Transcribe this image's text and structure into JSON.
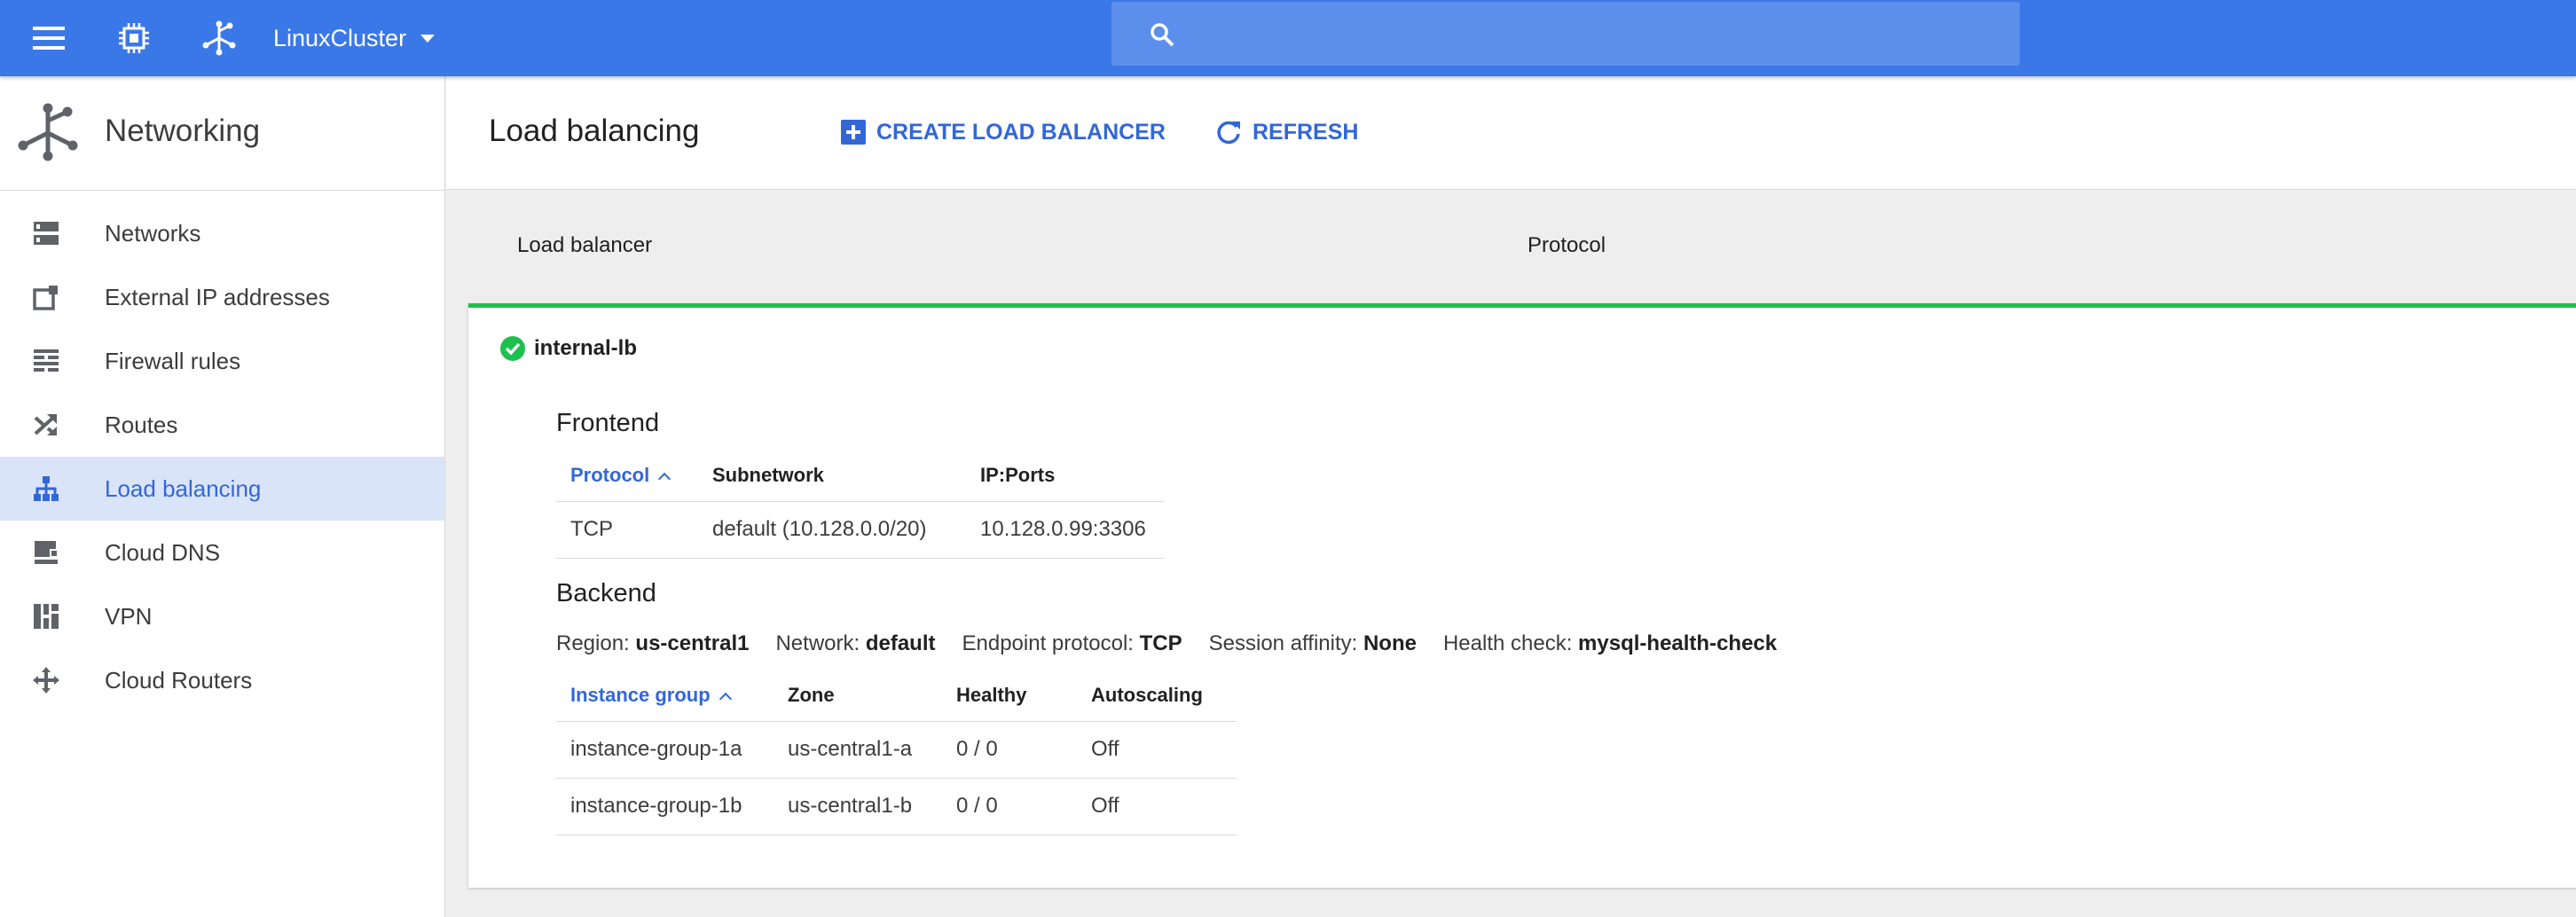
{
  "topbar": {
    "project": "LinuxCluster",
    "search_placeholder": ""
  },
  "sidebar": {
    "title": "Networking",
    "items": [
      {
        "label": "Networks",
        "icon": "networks-icon"
      },
      {
        "label": "External IP addresses",
        "icon": "external-ip-icon"
      },
      {
        "label": "Firewall rules",
        "icon": "firewall-icon"
      },
      {
        "label": "Routes",
        "icon": "routes-icon"
      },
      {
        "label": "Load balancing",
        "icon": "load-balancing-icon",
        "active": true
      },
      {
        "label": "Cloud DNS",
        "icon": "cloud-dns-icon"
      },
      {
        "label": "VPN",
        "icon": "vpn-icon"
      },
      {
        "label": "Cloud Routers",
        "icon": "cloud-routers-icon"
      }
    ]
  },
  "main": {
    "title": "Load balancing",
    "create_label": "CREATE LOAD BALANCER",
    "refresh_label": "REFRESH",
    "columns": [
      "Load balancer",
      "Protocol"
    ],
    "lb": {
      "name": "internal-lb",
      "frontend": {
        "title": "Frontend",
        "headers": [
          "Protocol",
          "Subnetwork",
          "IP:Ports"
        ],
        "rows": [
          [
            "TCP",
            "default (10.128.0.0/20)",
            "10.128.0.99:3306"
          ]
        ]
      },
      "backend": {
        "title": "Backend",
        "info": [
          {
            "key": "Region:",
            "value": "us-central1"
          },
          {
            "key": "Network:",
            "value": "default"
          },
          {
            "key": "Endpoint protocol:",
            "value": "TCP"
          },
          {
            "key": "Session affinity:",
            "value": "None"
          },
          {
            "key": "Health check:",
            "value": "mysql-health-check"
          }
        ],
        "headers": [
          "Instance group",
          "Zone",
          "Healthy",
          "Autoscaling"
        ],
        "rows": [
          [
            "instance-group-1a",
            "us-central1-a",
            "0 / 0",
            "Off"
          ],
          [
            "instance-group-1b",
            "us-central1-b",
            "0 / 0",
            "Off"
          ]
        ]
      }
    }
  },
  "colors": {
    "topbar": "#3b78e7",
    "accent": "#3367d6",
    "success": "#1fbf4f",
    "active_bg": "#dae4f9"
  }
}
